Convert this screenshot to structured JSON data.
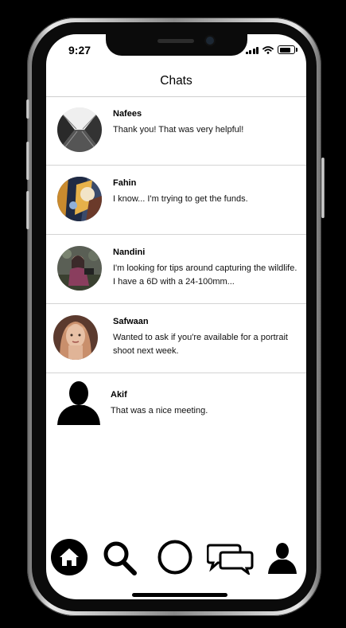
{
  "status_bar": {
    "time": "9:27"
  },
  "header": {
    "title": "Chats"
  },
  "chats": [
    {
      "name": "Nafees",
      "message": "Thank you! That was very helpful!",
      "avatar": "photo"
    },
    {
      "name": "Fahin",
      "message": "I know... I'm trying to get the funds.",
      "avatar": "photo"
    },
    {
      "name": "Nandini",
      "message": "I'm looking for tips around capturing the wildlife. I have a 6D with a 24-100mm...",
      "avatar": "photo"
    },
    {
      "name": "Safwaan",
      "message": "Wanted to ask if you're available for a portrait shoot next week.",
      "avatar": "photo"
    },
    {
      "name": "Akif",
      "message": "That was a nice meeting.",
      "avatar": "silhouette"
    }
  ],
  "tabbar": {
    "items": [
      "home-icon",
      "search-icon",
      "circle-icon",
      "chat-bubbles-icon",
      "profile-icon"
    ],
    "active": "home-icon"
  }
}
